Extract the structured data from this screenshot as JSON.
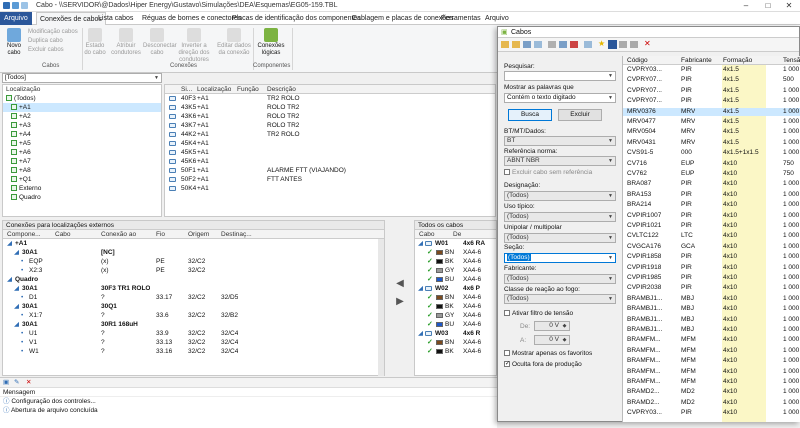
{
  "window": {
    "title": "Cabo - \\\\SERVIDOR\\@Dados\\Hiper Energy\\Gustavo\\Simulações\\DEA\\Esquemas\\EG05-159.TBL"
  },
  "tabs": [
    "Arquivo",
    "Conexões de cabos",
    "Lista cabos",
    "Réguas de bornes e conectores",
    "Placas de identificação dos componentes",
    "Cablagem e placas de conexões",
    "Ferramentas",
    "Arquivo"
  ],
  "ribbon": {
    "new_cable": "Novo cabo",
    "mod_cable": "Modificação cabos",
    "dup_cable": "Duplica cabo",
    "del_cable": "Excluir cabos",
    "group_cables": "Cabos",
    "state": "Estado do cabo",
    "assign": "Atribuir condutores",
    "disconnect": "Desconectar cabo",
    "invert": "Inverter a direção dos condutores",
    "edit_data": "Editar dados da conexão",
    "group_connections": "Conexões",
    "logical": "Conexões lógicas",
    "group_components": "Componentes"
  },
  "location_filter": "[Todos]",
  "locations": {
    "header": "Localização",
    "items": [
      "(Todos)",
      "+A1",
      "+A2",
      "+A3",
      "+A4",
      "+A5",
      "+A6",
      "+A7",
      "+A8",
      "+Q1",
      "Externo",
      "Quadro"
    ]
  },
  "components": {
    "headers": [
      "Si...",
      "Localização",
      "Função",
      "Descrição"
    ],
    "rows": [
      [
        "40F3",
        "+A1",
        "",
        "TR2 ROLO"
      ],
      [
        "43K5",
        "+A1",
        "",
        "ROLO TR2"
      ],
      [
        "43K6",
        "+A1",
        "",
        "ROLO TR2"
      ],
      [
        "43K7",
        "+A1",
        "",
        "ROLO TR2"
      ],
      [
        "44K2",
        "+A1",
        "",
        "TR2 ROLO"
      ],
      [
        "45K4",
        "+A1",
        "",
        ""
      ],
      [
        "45K5",
        "+A1",
        "",
        ""
      ],
      [
        "45K6",
        "+A1",
        "",
        ""
      ],
      [
        "50F1",
        "+A1",
        "",
        "ALARME FTT (VIAJANDO)"
      ],
      [
        "50F2",
        "+A1",
        "",
        "FTT ANTES"
      ],
      [
        "50K4",
        "+A1",
        "",
        ""
      ]
    ]
  },
  "ext_conn": {
    "title": "Conexões para localizações externos",
    "headers": [
      "Compone...",
      "Cabo",
      "Conexão ao",
      "Fio",
      "Origem",
      "Destinaç..."
    ],
    "rows": [
      [
        "+A1",
        "",
        "",
        "",
        "",
        ""
      ],
      [
        "30A1",
        "",
        "[NC]",
        "",
        "",
        ""
      ],
      [
        "EQP",
        "",
        "(x)",
        "PE",
        "32/C2",
        ""
      ],
      [
        "X2:3",
        "",
        "(x)",
        "PE",
        "32/C2",
        ""
      ],
      [
        "Quadro",
        "",
        "",
        "",
        "",
        ""
      ],
      [
        "30A1",
        "",
        "30F3 TR1 ROLO",
        "",
        "",
        ""
      ],
      [
        "D1",
        "",
        "?",
        "33.17",
        "32/C2",
        "32/D5"
      ],
      [
        "30A1",
        "",
        "30Q1",
        "",
        "",
        ""
      ],
      [
        "X1:7",
        "",
        "?",
        "33.6",
        "32/C2",
        "32/B2"
      ],
      [
        "30A1",
        "",
        "30R1 168uH",
        "",
        "",
        ""
      ],
      [
        "U1",
        "",
        "?",
        "33.9",
        "32/C2",
        "32/C4"
      ],
      [
        "V1",
        "",
        "?",
        "33.13",
        "32/C2",
        "32/C4"
      ],
      [
        "W1",
        "",
        "?",
        "33.16",
        "32/C2",
        "32/C4"
      ]
    ]
  },
  "all_cables": {
    "title": "Todos os cabos",
    "headers": [
      "Cabo",
      "De"
    ],
    "rows": [
      [
        "W01",
        "4x6 RA"
      ],
      [
        "BN",
        "XA4-6"
      ],
      [
        "BK",
        "XA4-6"
      ],
      [
        "GY",
        "XA4-6"
      ],
      [
        "BU",
        "XA4-6"
      ],
      [
        "W02",
        "4x6 P"
      ],
      [
        "BN",
        "XA4-6"
      ],
      [
        "BK",
        "XA4-6"
      ],
      [
        "GY",
        "XA4-6"
      ],
      [
        "BU",
        "XA4-6"
      ],
      [
        "W03",
        "4x6 R"
      ],
      [
        "BN",
        "XA4-6"
      ],
      [
        "BK",
        "XA4-6"
      ]
    ]
  },
  "messages": {
    "header": "Mensagem",
    "items": [
      "Configuração dos controles...",
      "Abertura de arquivo concluída"
    ]
  },
  "dialog": {
    "title": "Cabos",
    "search_label": "Pesquisar:",
    "search_value": "",
    "show_words_label": "Mostrar as palavras que",
    "show_words_value": "Contém o texto digitado",
    "search_btn": "Busca",
    "delete_btn": "Excluir",
    "bt_label": "BT/MT/Dados:",
    "bt_value": "BT",
    "ref_label": "Referência norma:",
    "ref_value": "ABNT NBR",
    "exclude_no_ref": "Excluir cabo sem referência",
    "designation_label": "Designação:",
    "designation_value": "(Todos)",
    "usage_label": "Uso típico:",
    "usage_value": "(Todos)",
    "unipolar_label": "Unipolar / multipolar",
    "unipolar_value": "(Todos)",
    "section_label": "Seção:",
    "section_value": "(Todos)",
    "maker_label": "Fabricante:",
    "maker_value": "(Todos)",
    "fire_label": "Classe de reação ao fogo:",
    "fire_value": "(Todos)",
    "voltage_filter": "Ativar filtro de tensão",
    "de_label": "De:",
    "de_value": "0 V",
    "a_label": "A:",
    "a_value": "0 V",
    "favorites": "Mostrar apenas os favoritos",
    "hide_out": "Oculta fora de produção",
    "grid_headers": [
      "Código",
      "Fabricante",
      "Formação",
      "Tensão"
    ],
    "grid_rows": [
      [
        "CVPRY03...",
        "PIR",
        "4x1.5",
        "1 000"
      ],
      [
        "CVPRY07...",
        "PIR",
        "4x1.5",
        "500"
      ],
      [
        "CVPRY07...",
        "PIR",
        "4x1.5",
        "1 000"
      ],
      [
        "CVPRY07...",
        "PIR",
        "4x1.5",
        "1 000"
      ],
      [
        "MRV0376",
        "MRV",
        "4x1.5",
        "1 000"
      ],
      [
        "MRV0477",
        "MRV",
        "4x1.5",
        "1 000"
      ],
      [
        "MRV0504",
        "MRV",
        "4x1.5",
        "1 000"
      ],
      [
        "MRV0431",
        "MRV",
        "4x1.5",
        "1 000"
      ],
      [
        "CVS91-5",
        "000",
        "4x1.5+1x1.5",
        "1 000"
      ],
      [
        "CV716",
        "EUP",
        "4x10",
        "750"
      ],
      [
        "CV762",
        "EUP",
        "4x10",
        "750"
      ],
      [
        "BRA087",
        "PIR",
        "4x10",
        "1 000"
      ],
      [
        "BRA153",
        "PIR",
        "4x10",
        "1 000"
      ],
      [
        "BRA214",
        "PIR",
        "4x10",
        "1 000"
      ],
      [
        "CVPIR1007",
        "PIR",
        "4x10",
        "1 000"
      ],
      [
        "CVPIR1021",
        "PIR",
        "4x10",
        "1 000"
      ],
      [
        "CVLTC122",
        "LTC",
        "4x10",
        "1 000"
      ],
      [
        "CVGCA176",
        "GCA",
        "4x10",
        "1 000"
      ],
      [
        "CVPIR1858",
        "PIR",
        "4x10",
        "1 000"
      ],
      [
        "CVPIR1918",
        "PIR",
        "4x10",
        "1 000"
      ],
      [
        "CVPIR1985",
        "PIR",
        "4x10",
        "1 000"
      ],
      [
        "CVPIR2038",
        "PIR",
        "4x10",
        "1 000"
      ],
      [
        "BRAMBJ1...",
        "MBJ",
        "4x10",
        "1 000"
      ],
      [
        "BRAMBJ1...",
        "MBJ",
        "4x10",
        "1 000"
      ],
      [
        "BRAMBJ1...",
        "MBJ",
        "4x10",
        "1 000"
      ],
      [
        "BRAMBJ1...",
        "MBJ",
        "4x10",
        "1 000"
      ],
      [
        "BRAMFM...",
        "MFM",
        "4x10",
        "1 000"
      ],
      [
        "BRAMFM...",
        "MFM",
        "4x10",
        "1 000"
      ],
      [
        "BRAMFM...",
        "MFM",
        "4x10",
        "1 000"
      ],
      [
        "BRAMFM...",
        "MFM",
        "4x10",
        "1 000"
      ],
      [
        "BRAMFM...",
        "MFM",
        "4x10",
        "1 000"
      ],
      [
        "BRAMD2...",
        "MD2",
        "4x10",
        "1 000"
      ],
      [
        "BRAMD2...",
        "MD2",
        "4x10",
        "1 000"
      ],
      [
        "CVPRY03...",
        "PIR",
        "4x10",
        "1 000"
      ]
    ]
  },
  "colors": {
    "accent": "#2b579a",
    "selection": "#cce8ff",
    "formation_col": "#fbf7c6",
    "check": "#2a9d2a"
  }
}
